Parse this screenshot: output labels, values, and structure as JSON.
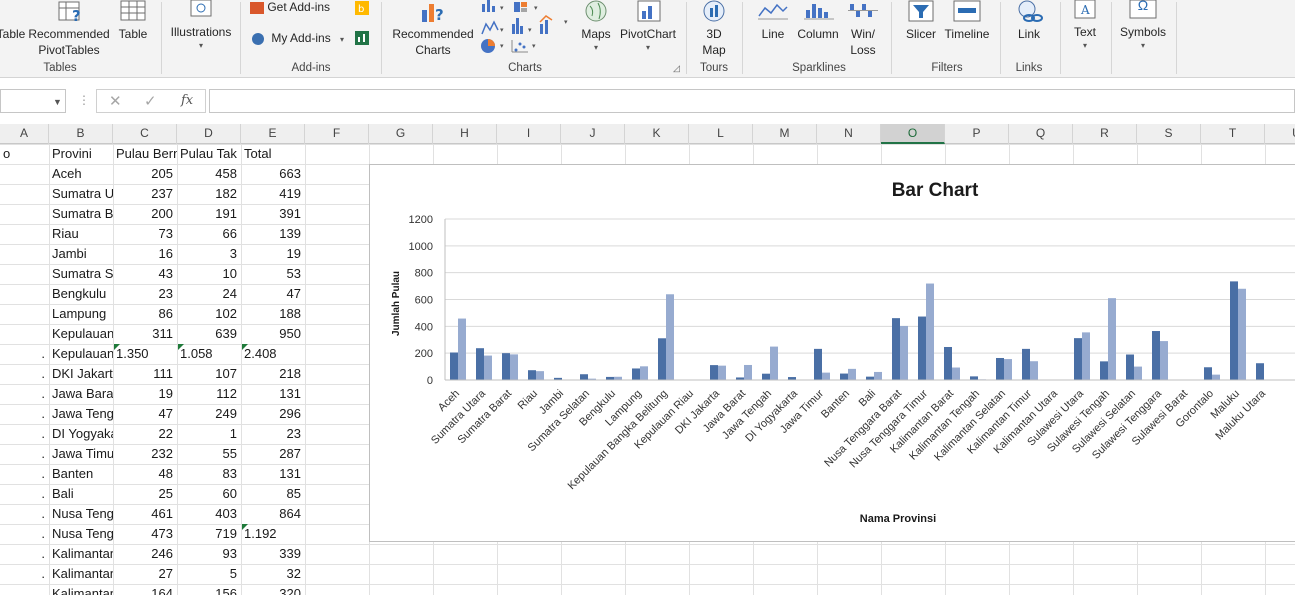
{
  "ribbon": {
    "pivot_table_label": "Table",
    "recommended_pivot_line1": "Recommended",
    "recommended_pivot_line2": "PivotTables",
    "table_label": "Table",
    "tables_group": "Tables",
    "illustrations_label": "Illustrations",
    "get_addins_label": "Get Add-ins",
    "my_addins_label": "My Add-ins",
    "addins_group": "Add-ins",
    "recommended_charts_line1": "Recommended",
    "recommended_charts_line2": "Charts",
    "maps_label": "Maps",
    "pivotchart_label": "PivotChart",
    "charts_group": "Charts",
    "map3d_line1": "3D",
    "map3d_line2": "Map",
    "tours_group": "Tours",
    "line_label": "Line",
    "column_label": "Column",
    "winloss_line1": "Win/",
    "winloss_line2": "Loss",
    "sparklines_group": "Sparklines",
    "slicer_label": "Slicer",
    "timeline_label": "Timeline",
    "filters_group": "Filters",
    "link_label": "Link",
    "links_group": "Links",
    "text_label": "Text",
    "symbols_label": "Symbols",
    "omega": "Ω"
  },
  "formula_bar": {
    "cancel": "✕",
    "enter": "✓",
    "fx": "fx",
    "value": ""
  },
  "columns": [
    "A",
    "B",
    "C",
    "D",
    "E",
    "F",
    "G",
    "H",
    "I",
    "J",
    "K",
    "L",
    "M",
    "N",
    "O",
    "P",
    "Q",
    "R",
    "S",
    "T",
    "U"
  ],
  "selected_column": "O",
  "header_row": {
    "a": "o",
    "b": "Provini",
    "c": "Pulau Bern",
    "d": "Pulau Tak",
    "e": "Total"
  },
  "rows": [
    {
      "a": "",
      "b": "Aceh",
      "c": "205",
      "d": "458",
      "e": "663"
    },
    {
      "a": "",
      "b": "Sumatra Utara",
      "c": "237",
      "d": "182",
      "e": "419"
    },
    {
      "a": "",
      "b": "Sumatra Barat",
      "c": "200",
      "d": "191",
      "e": "391"
    },
    {
      "a": "",
      "b": "Riau",
      "c": "73",
      "d": "66",
      "e": "139"
    },
    {
      "a": "",
      "b": "Jambi",
      "c": "16",
      "d": "3",
      "e": "19"
    },
    {
      "a": "",
      "b": "Sumatra Selatan",
      "c": "43",
      "d": "10",
      "e": "53"
    },
    {
      "a": "",
      "b": "Bengkulu",
      "c": "23",
      "d": "24",
      "e": "47"
    },
    {
      "a": "",
      "b": "Lampung",
      "c": "86",
      "d": "102",
      "e": "188"
    },
    {
      "a": "",
      "b": "Kepulauan Bangka Belitung",
      "c": "311",
      "d": "639",
      "e": "950"
    },
    {
      "a": ".",
      "b": "Kepulauan Riau",
      "c": "1.350",
      "d": "1.058",
      "e": "2.408"
    },
    {
      "a": ".",
      "b": "DKI Jakarta",
      "c": "111",
      "d": "107",
      "e": "218"
    },
    {
      "a": ".",
      "b": "Jawa Barat",
      "c": "19",
      "d": "112",
      "e": "131"
    },
    {
      "a": ".",
      "b": "Jawa Tengah",
      "c": "47",
      "d": "249",
      "e": "296"
    },
    {
      "a": ".",
      "b": "DI Yogyakarta",
      "c": "22",
      "d": "1",
      "e": "23"
    },
    {
      "a": ".",
      "b": "Jawa Timur",
      "c": "232",
      "d": "55",
      "e": "287"
    },
    {
      "a": ".",
      "b": "Banten",
      "c": "48",
      "d": "83",
      "e": "131"
    },
    {
      "a": ".",
      "b": "Bali",
      "c": "25",
      "d": "60",
      "e": "85"
    },
    {
      "a": ".",
      "b": "Nusa Tenggara Barat",
      "c": "461",
      "d": "403",
      "e": "864"
    },
    {
      "a": ".",
      "b": "Nusa Tenggara Timur",
      "c": "473",
      "d": "719",
      "e": "1.192"
    },
    {
      "a": ".",
      "b": "Kalimantan Barat",
      "c": "246",
      "d": "93",
      "e": "339"
    },
    {
      "a": ".",
      "b": "Kalimantan Tengah",
      "c": "27",
      "d": "5",
      "e": "32"
    },
    {
      "a": ".",
      "b": "Kalimantan Selatan",
      "c": "164",
      "d": "156",
      "e": "320"
    }
  ],
  "chart_data": {
    "type": "bar",
    "title": "Bar Chart",
    "xlabel": "Nama Provinsi",
    "ylabel": "Jumlah Pulau",
    "ylim": [
      0,
      1200
    ],
    "yticks": [
      "0",
      "200",
      "400",
      "600",
      "800",
      "1000",
      "1200"
    ],
    "grid": true,
    "categories": [
      "Aceh",
      "Sumatra Utara",
      "Sumatra Barat",
      "Riau",
      "Jambi",
      "Sumatra Selatan",
      "Bengkulu",
      "Lampung",
      "Kepulauan Bangka Belitung",
      "Kepulauan Riau",
      "DKI Jakarta",
      "Jawa Barat",
      "Jawa Tengah",
      "DI Yogyakarta",
      "Jawa Timur",
      "Banten",
      "Bali",
      "Nusa Tenggara Barat",
      "Nusa Tenggara Timur",
      "Kalimantan Barat",
      "Kalimantan Tengah",
      "Kalimantan Selatan",
      "Kalimantan Timur",
      "Kalimantan Utara",
      "Sulawesi Utara",
      "Sulawesi Tengah",
      "Sulawesi Selatan",
      "Sulawesi Tenggara",
      "Sulawesi Barat",
      "Gorontalo",
      "Maluku",
      "Maluku Utara"
    ],
    "series": [
      {
        "color": "#4a6fa5",
        "values": [
          205,
          237,
          200,
          73,
          16,
          43,
          23,
          86,
          311,
          0,
          111,
          19,
          47,
          22,
          232,
          48,
          25,
          461,
          473,
          246,
          27,
          164,
          232,
          0,
          312,
          139,
          190,
          365,
          0,
          95,
          735,
          125
        ]
      },
      {
        "color": "#97abd0",
        "values": [
          458,
          182,
          191,
          66,
          3,
          10,
          24,
          102,
          639,
          0,
          107,
          112,
          249,
          1,
          55,
          83,
          60,
          403,
          719,
          93,
          5,
          156,
          140,
          0,
          355,
          610,
          100,
          290,
          0,
          40,
          680,
          0
        ]
      }
    ]
  }
}
